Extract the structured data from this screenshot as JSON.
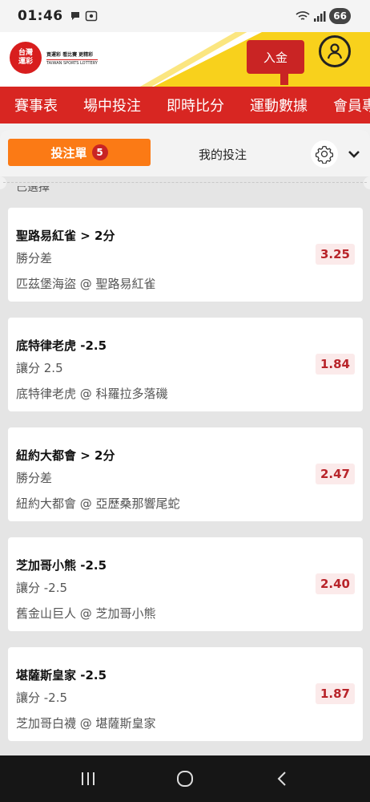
{
  "status_bar": {
    "time": "01:46",
    "battery": "66"
  },
  "header": {
    "logo_main": "台灣運彩",
    "logo_tagline": "買運彩 看比賽 更精彩",
    "logo_english": "TAIWAN SPORTS LOTTERY",
    "deposit_label": "入金"
  },
  "nav": {
    "items": [
      "賽事表",
      "場中投注",
      "即時比分",
      "運動數據",
      "會員專區"
    ]
  },
  "tabs": {
    "slip_label": "投注單",
    "slip_count": "5",
    "mine_label": "我的投注"
  },
  "partial_text": "已選擇",
  "bets": [
    {
      "team": "聖路易紅雀 > 2分",
      "market": "勝分差",
      "match": "匹茲堡海盜 @ 聖路易紅雀",
      "odds": "3.25"
    },
    {
      "team": "底特律老虎 -2.5",
      "market": "讓分 2.5",
      "match": "底特律老虎 @ 科羅拉多落磯",
      "odds": "1.84"
    },
    {
      "team": "紐約大都會 > 2分",
      "market": "勝分差",
      "match": "紐約大都會 @ 亞歷桑那響尾蛇",
      "odds": "2.47"
    },
    {
      "team": "芝加哥小熊 -2.5",
      "market": "讓分 -2.5",
      "match": "舊金山巨人 @ 芝加哥小熊",
      "odds": "2.40"
    },
    {
      "team": "堪薩斯皇家 -2.5",
      "market": "讓分 -2.5",
      "match": "芝加哥白襪 @ 堪薩斯皇家",
      "odds": "1.87"
    }
  ],
  "colors": {
    "brand_red": "#d82622",
    "accent_orange": "#fb7a15",
    "header_yellow": "#f8d11c",
    "odds_red": "#b8242a"
  }
}
